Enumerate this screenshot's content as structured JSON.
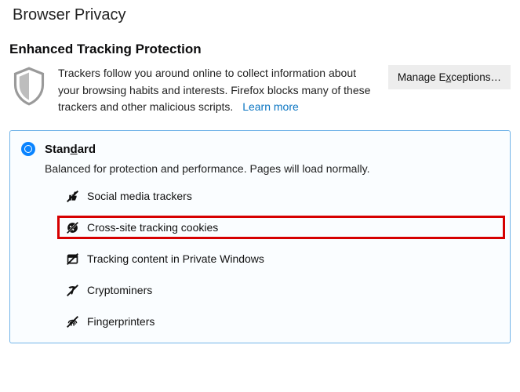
{
  "page": {
    "title": "Browser Privacy"
  },
  "etp": {
    "heading": "Enhanced Tracking Protection",
    "description": "Trackers follow you around online to collect information about your browsing habits and interests. Firefox blocks many of these trackers and other malicious scripts.",
    "learn_more": "Learn more",
    "manage_exceptions": "Manage Exceptions…"
  },
  "option": {
    "name_pre": "Stan",
    "name_ul": "d",
    "name_post": "ard",
    "description": "Balanced for protection and performance. Pages will load normally.",
    "trackers": [
      "Social media trackers",
      "Cross-site tracking cookies",
      "Tracking content in Private Windows",
      "Cryptominers",
      "Fingerprinters"
    ]
  }
}
